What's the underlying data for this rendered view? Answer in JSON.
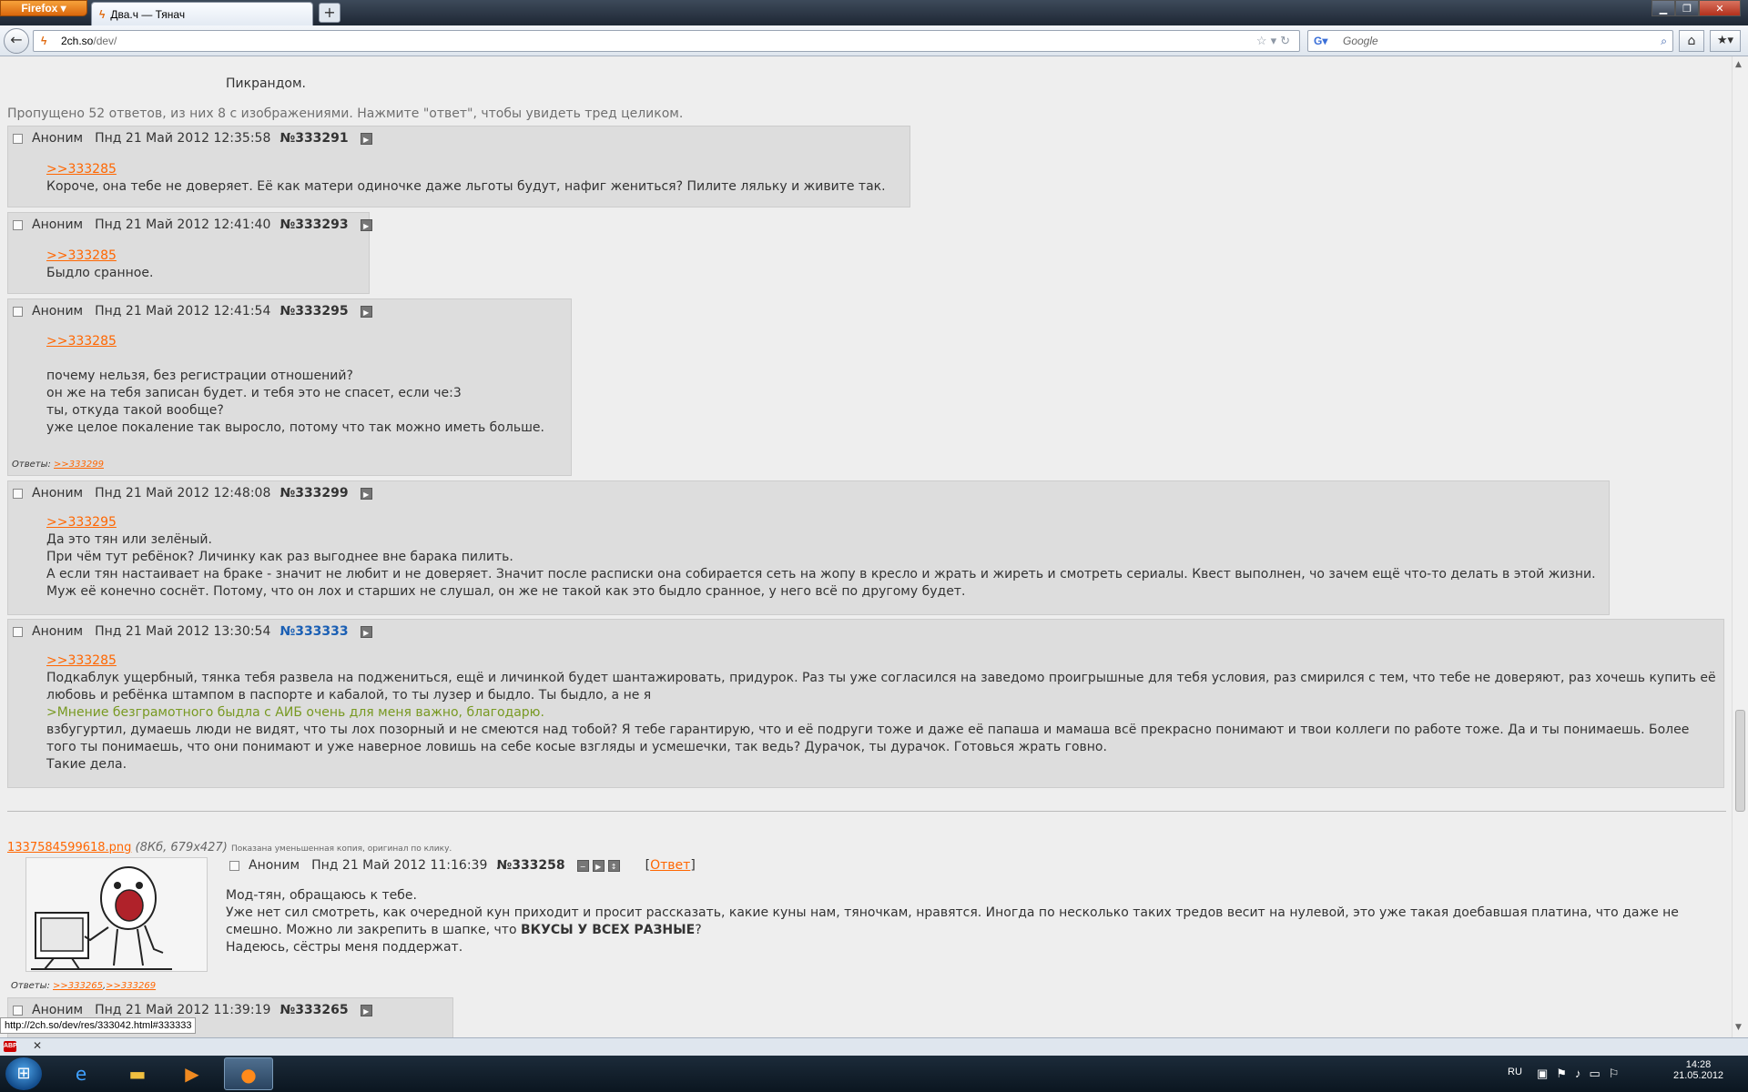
{
  "browser": {
    "app_button": "Firefox",
    "tab_title": "Два.ч — Тянач",
    "new_tab": "+",
    "url_host": "2ch.so",
    "url_path": "/dev/",
    "search_placeholder": "Google"
  },
  "thread_intro": {
    "text": "Пикрандом.",
    "omitted": "Пропущено 52 ответов, из них 8 с изображениями. Нажмите \"ответ\", чтобы увидеть тред целиком."
  },
  "posts": [
    {
      "name": "Аноним",
      "date": "Пнд 21 Май 2012 12:35:58",
      "num": "№333291",
      "ref": ">>333285",
      "lines": [
        "Короче, она тебе не доверяет. Её как матери одиночке даже льготы будут, нафиг жениться? Пилите ляльку и живите так."
      ]
    },
    {
      "name": "Аноним",
      "date": "Пнд 21 Май 2012 12:41:40",
      "num": "№333293",
      "ref": ">>333285",
      "lines": [
        "Быдло сранное."
      ]
    },
    {
      "name": "Аноним",
      "date": "Пнд 21 Май 2012 12:41:54",
      "num": "№333295",
      "ref": ">>333285",
      "lines": [
        "почему нельзя, без регистрации отношений?",
        "он же на тебя записан будет. и тебя это не спасет, если че:3",
        "ты, откуда такой вообще?",
        "уже целое покаление так выросло, потому что так можно иметь больше."
      ],
      "replies_label": "Ответы:",
      "replies": [
        ">>333299"
      ]
    },
    {
      "name": "Аноним",
      "date": "Пнд 21 Май 2012 12:48:08",
      "num": "№333299",
      "ref": ">>333295",
      "lines": [
        "Да это тян или зелёный.",
        "При чём тут ребёнок? Личинку как раз выгоднее вне барака пилить.",
        "А если тян настаивает на браке - значит не любит и не доверяет. Значит после расписки она собирается сеть на жопу в кресло и жрать и жиреть и смотреть сериалы. Квест выполнен, чо зачем ещё что-то делать в этой жизни.",
        "Муж её конечно соснёт. Потому, что он лох и старших не слушал, он же не такой как это быдло сранное, у него всё по другому будет."
      ]
    },
    {
      "name": "Аноним",
      "date": "Пнд 21 Май 2012 13:30:54",
      "num": "№333333",
      "ref": ">>333285",
      "lines": [
        "Подкаблук ущербный, тянка тебя развела на подженитьcя, ещё и личинкой будет шантажировать, придурок. Раз ты уже согласился на заведомо проигрышные для тебя условия, раз смирился с тем, что тебе не доверяют, раз хочешь купить её",
        "любовь и ребёнка штампом в паспорте и кабалой, то ты лузер и быдло. Ты быдло, а не я"
      ],
      "greentext": ">Мнение безграмотного быдла с АИБ очень для меня важно, благодарю.",
      "lines_after": [
        "взбугуртил, думаешь люди не видят, что ты лох позорный и не смеются над тобой? Я тебе гарантирую, что и её подруги тоже и даже её папаша и мамаша всё прекрасно понимают и твои коллеги по работе тоже. Да и ты понимаешь. Более",
        "того ты понимаешь, что они понимают и уже наверное ловишь на себе косые взгляды и усмешечки, так ведь? Дурачок, ты дурачок. Готовься жрать говно.",
        "Такие дела."
      ]
    }
  ],
  "next_thread": {
    "file_link": "1337584599618.png",
    "file_info": "(8Кб, 679x427)",
    "file_note": "Показана уменьшенная копия, оригинал по клику.",
    "name": "Аноним",
    "date": "Пнд 21 Май 2012 11:16:39",
    "num": "№333258",
    "reply_open": "[",
    "reply_label": "Ответ",
    "reply_close": "]",
    "lines": [
      "Мод-тян, обращаюсь к тебе.",
      "Уже нет сил смотреть, как очередной кун приходит и просит рассказать, какие куны нам, тяночкам, нравятся. Иногда по несколько таких тредов весит на нулевой, это уже такая доебавшая платина, что даже не"
    ],
    "line3_pre": "смешно. Можно ли закрепить в шапке, что ",
    "line3_bold": "ВКУСЫ У ВСЕХ РАЗНЫЕ",
    "line3_post": "?",
    "line4": "Надеюсь, сёстры меня поддержат.",
    "replies_label": "Ответы:",
    "replies": [
      ">>333265",
      ">>333269"
    ]
  },
  "partial_post": {
    "name": "Аноним",
    "date": "Пнд 21 Май 2012 11:39:19",
    "num": "№333265"
  },
  "status_url": "http://2ch.so/dev/res/333042.html#333333",
  "taskbar": {
    "lang": "RU",
    "time": "14:28",
    "date": "21.05.2012"
  },
  "colors": {
    "post_bg": "#dddddd",
    "link": "#ff6600",
    "greentext": "#789922",
    "highlight_num": "#1a5fb4"
  }
}
